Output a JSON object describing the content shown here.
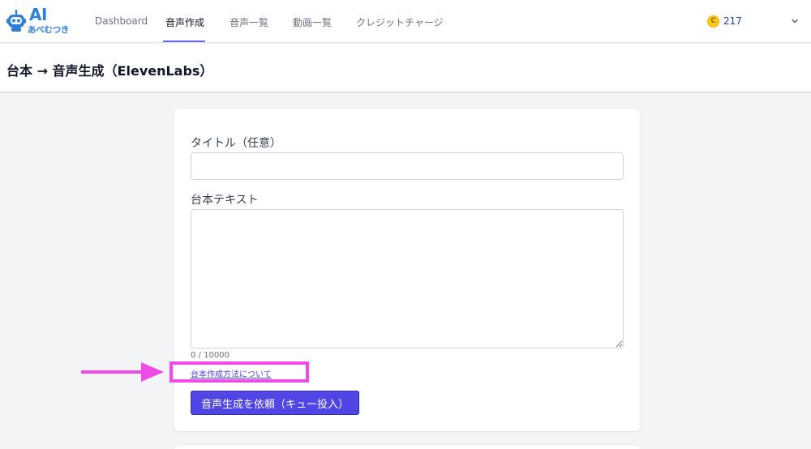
{
  "logo": {
    "main": "AI",
    "sub": "あべむつき"
  },
  "nav": {
    "items": [
      {
        "label": "Dashboard"
      },
      {
        "label": "音声作成"
      },
      {
        "label": "音声一覧"
      },
      {
        "label": "動画一覧"
      },
      {
        "label": "クレジットチャージ"
      }
    ],
    "active_index": 1,
    "credits": "217",
    "coin_symbol": "C"
  },
  "page": {
    "title": "台本 → 音声生成（ElevenLabs）"
  },
  "form": {
    "title_label": "タイトル（任意）",
    "title_value": "",
    "script_label": "台本テキスト",
    "script_value": "",
    "counter": "0 / 10000",
    "howto_link": "台本作成方法について",
    "submit_label": "音声生成を依頼（キュー投入）"
  },
  "colors": {
    "accent": "#4f46e5",
    "annotation": "#ee4be7",
    "brand": "#2f7fd6"
  }
}
